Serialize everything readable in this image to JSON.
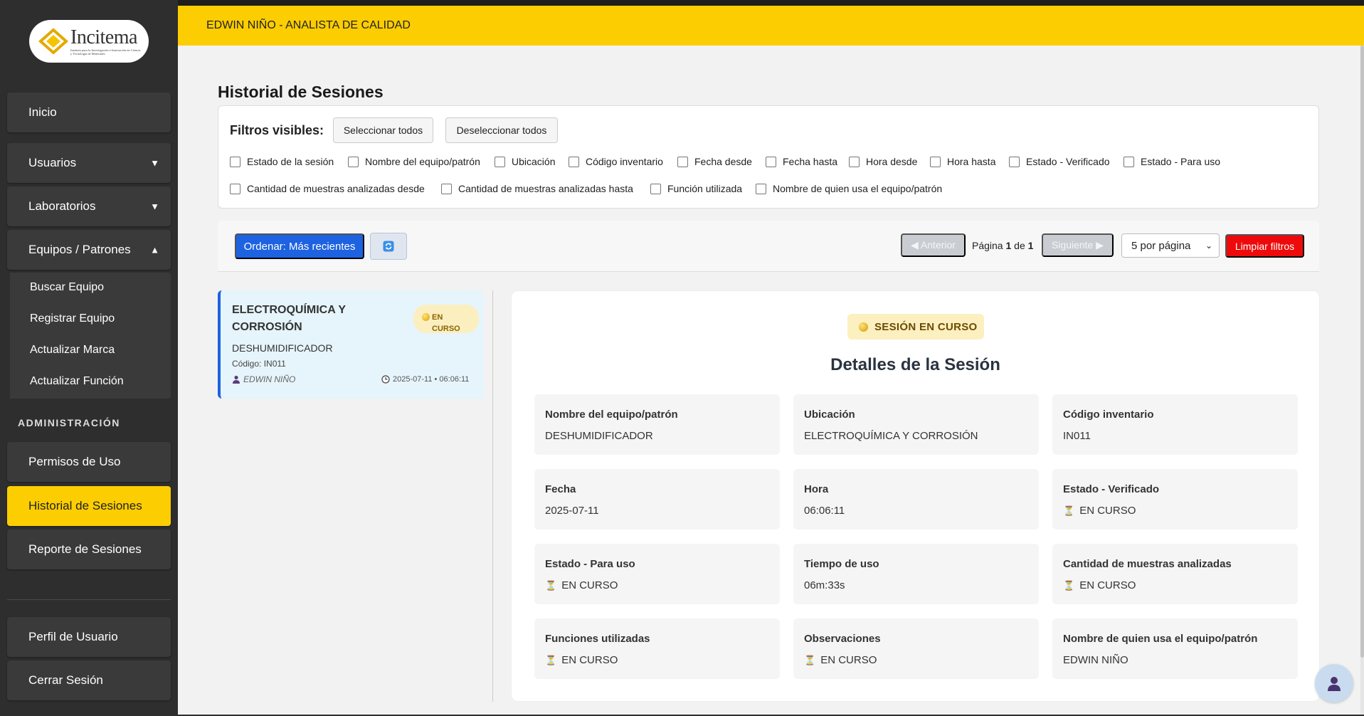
{
  "brand": {
    "logo_text": "Incitema",
    "logo_subtitle": "Instituto para la Investigación e Innovación en Ciencia y Tecnología de Materiales"
  },
  "header": {
    "user_role": "EDWIN NIÑO - ANALISTA DE CALIDAD"
  },
  "sidebar": {
    "items": [
      {
        "label": "Inicio"
      },
      {
        "label": "Usuarios",
        "caret": "▼"
      },
      {
        "label": "Laboratorios",
        "caret": "▼"
      },
      {
        "label": "Equipos / Patrones",
        "caret": "▲"
      }
    ],
    "sub_items": [
      {
        "label": "Buscar Equipo"
      },
      {
        "label": "Registrar Equipo"
      },
      {
        "label": "Actualizar Marca"
      },
      {
        "label": "Actualizar Función"
      }
    ],
    "section_label": "ADMINISTRACIÓN",
    "admin_items": [
      {
        "label": "Permisos de Uso"
      },
      {
        "label": "Historial de Sesiones",
        "active": true
      },
      {
        "label": "Reporte de Sesiones"
      }
    ],
    "bottom_items": [
      {
        "label": "Perfil de Usuario"
      },
      {
        "label": "Cerrar Sesión"
      }
    ]
  },
  "page": {
    "title": "Historial de Sesiones"
  },
  "filters": {
    "title": "Filtros visibles:",
    "select_all": "Seleccionar todos",
    "deselect_all": "Deseleccionar todos",
    "options": [
      "Estado de la sesión",
      "Nombre del equipo/patrón",
      "Ubicación",
      "Código inventario",
      "Fecha desde",
      "Fecha hasta",
      "Hora desde",
      "Hora hasta",
      "Estado - Verificado",
      "Estado - Para uso",
      "Cantidad de muestras analizadas desde",
      "Cantidad de muestras analizadas hasta",
      "Función utilizada",
      "Nombre de quien usa el equipo/patrón"
    ]
  },
  "toolbar": {
    "sort_label": "Ordenar: Más recientes",
    "prev_label": "◀ Anterior",
    "next_label": "Siguiente ▶",
    "page_prefix": "Página",
    "page_current": "1",
    "page_of": "de",
    "page_total": "1",
    "per_page": "5 por página",
    "clear_label": "Limpiar filtros"
  },
  "session_card": {
    "title": "ELECTROQUÍMICA Y CORROSIÓN",
    "badge_line1": "EN",
    "badge_line2": "CURSO",
    "equipment": "DESHUMIDIFICADOR",
    "code": "Código: IN011",
    "user": "EDWIN NIÑO",
    "datetime": "2025-07-11 • 06:06:11"
  },
  "detail": {
    "status": "SESIÓN EN CURSO",
    "title": "Detalles de la Sesión",
    "fields": [
      {
        "label": "Nombre del equipo/patrón",
        "value": "DESHUMIDIFICADOR",
        "pending": false
      },
      {
        "label": "Ubicación",
        "value": "ELECTROQUÍMICA Y CORROSIÓN",
        "pending": false
      },
      {
        "label": "Código inventario",
        "value": "IN011",
        "pending": false
      },
      {
        "label": "Fecha",
        "value": "2025-07-11",
        "pending": false
      },
      {
        "label": "Hora",
        "value": "06:06:11",
        "pending": false
      },
      {
        "label": "Estado - Verificado",
        "value": "EN CURSO",
        "pending": true
      },
      {
        "label": "Estado - Para uso",
        "value": "EN CURSO",
        "pending": true
      },
      {
        "label": "Tiempo de uso",
        "value": "06m:33s",
        "pending": false
      },
      {
        "label": "Cantidad de muestras analizadas",
        "value": "EN CURSO",
        "pending": true
      },
      {
        "label": "Funciones utilizadas",
        "value": "EN CURSO",
        "pending": true
      },
      {
        "label": "Observaciones",
        "value": "EN CURSO",
        "pending": true
      },
      {
        "label": "Nombre de quien usa el equipo/patrón",
        "value": "EDWIN NIÑO",
        "pending": false
      }
    ]
  },
  "colors": {
    "accent": "#fccd00",
    "primary": "#1d62e0",
    "danger": "#ee0a0a",
    "sidebar": "#2e2e2e"
  },
  "icons": {
    "refresh": "refresh-icon",
    "pending": "hourglass-icon",
    "status": "status-dot-icon",
    "user": "user-icon",
    "clock": "clock-icon",
    "chat": "user-avatar-icon"
  }
}
